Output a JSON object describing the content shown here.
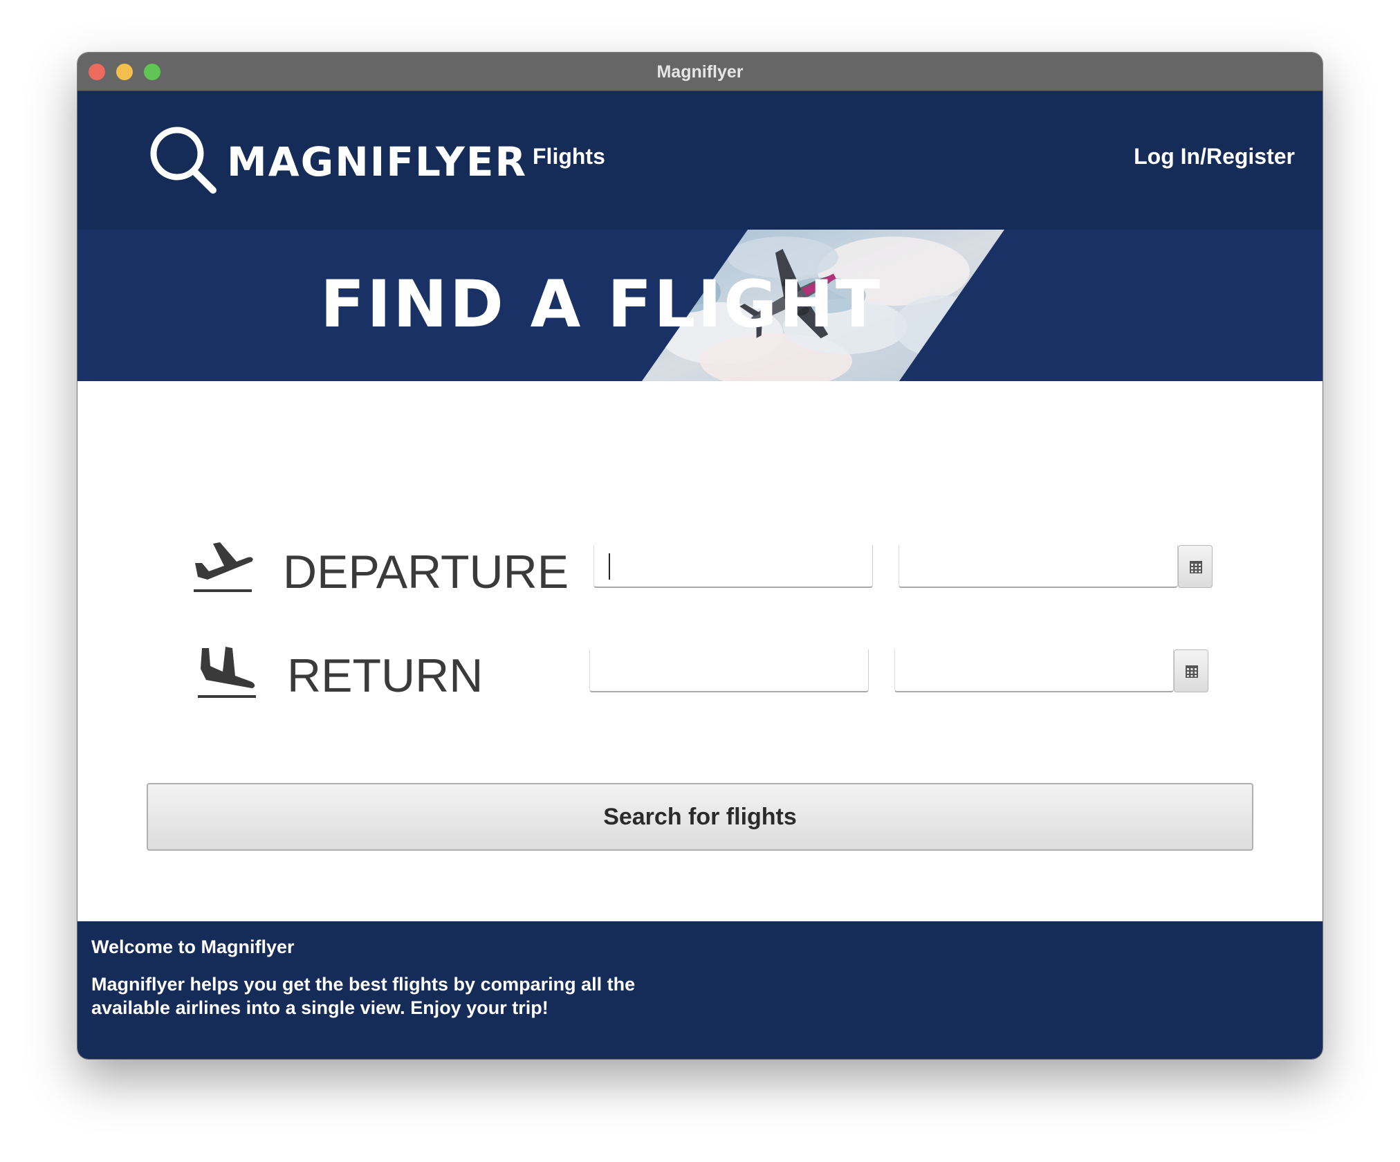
{
  "window": {
    "title": "Magniflyer"
  },
  "header": {
    "logo_text": "MAGNIFLYER",
    "nav_flights": "Flights",
    "nav_login": "Log In/Register"
  },
  "hero": {
    "title": "FIND A FLIGHT"
  },
  "form": {
    "departure_label": "DEPARTURE",
    "departure_location": "",
    "departure_date": "",
    "return_label": "RETURN",
    "return_location": "",
    "return_date": "",
    "search_button": "Search for flights"
  },
  "footer": {
    "heading": "Welcome to Magniflyer",
    "body": "Magniflyer helps you get the best flights by comparing all the available airlines into a single view. Enjoy your trip!"
  },
  "icons": {
    "logo": "magnifier-icon",
    "departure": "airplane-takeoff-icon",
    "return": "airplane-landing-icon",
    "calendar": "calendar-icon"
  },
  "colors": {
    "navy": "#152b58",
    "hero_navy": "#1a3166",
    "traffic_close": "#ed6a5e",
    "traffic_min": "#f5bf4f",
    "traffic_max": "#61c554"
  }
}
